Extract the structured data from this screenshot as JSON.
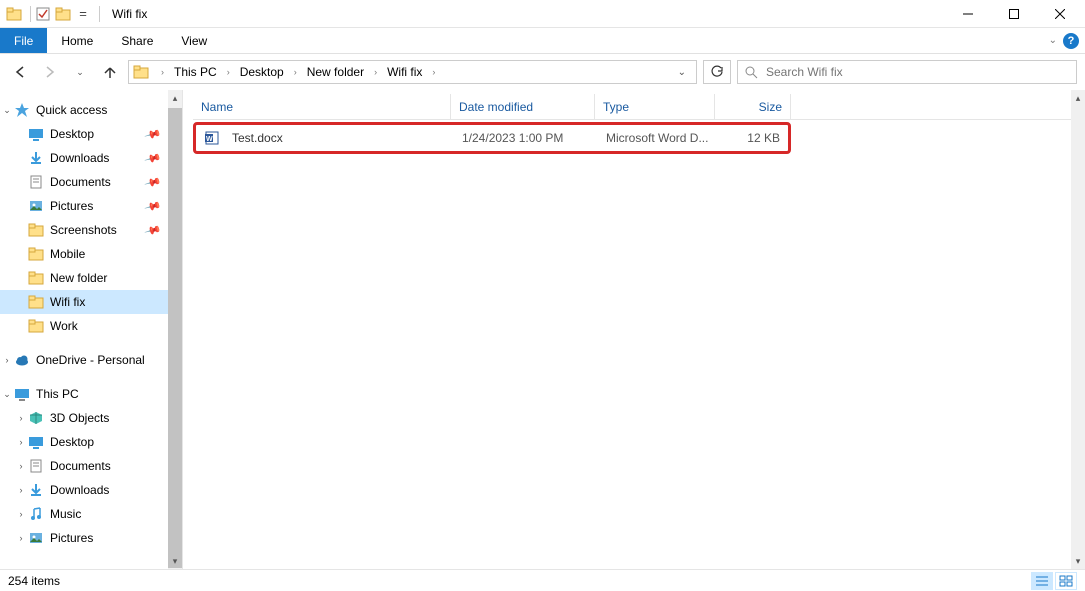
{
  "window": {
    "title": "Wifi fix"
  },
  "ribbon": {
    "file": "File",
    "home": "Home",
    "share": "Share",
    "view": "View"
  },
  "breadcrumbs": [
    "This PC",
    "Desktop",
    "New folder",
    "Wifi fix"
  ],
  "search": {
    "placeholder": "Search Wifi fix"
  },
  "sidebar": {
    "quick_access": "Quick access",
    "desktop": "Desktop",
    "downloads": "Downloads",
    "documents": "Documents",
    "pictures": "Pictures",
    "screenshots": "Screenshots",
    "mobile": "Mobile",
    "new_folder": "New folder",
    "wifi_fix": "Wifi fix",
    "work": "Work",
    "onedrive": "OneDrive - Personal",
    "this_pc": "This PC",
    "objects3d": "3D Objects",
    "desktop2": "Desktop",
    "documents2": "Documents",
    "downloads2": "Downloads",
    "music": "Music",
    "pictures2": "Pictures"
  },
  "columns": {
    "name": "Name",
    "date": "Date modified",
    "type": "Type",
    "size": "Size"
  },
  "files": [
    {
      "name": "Test.docx",
      "date": "1/24/2023 1:00 PM",
      "type": "Microsoft Word D...",
      "size": "12 KB"
    }
  ],
  "status": {
    "count": "254 items"
  }
}
